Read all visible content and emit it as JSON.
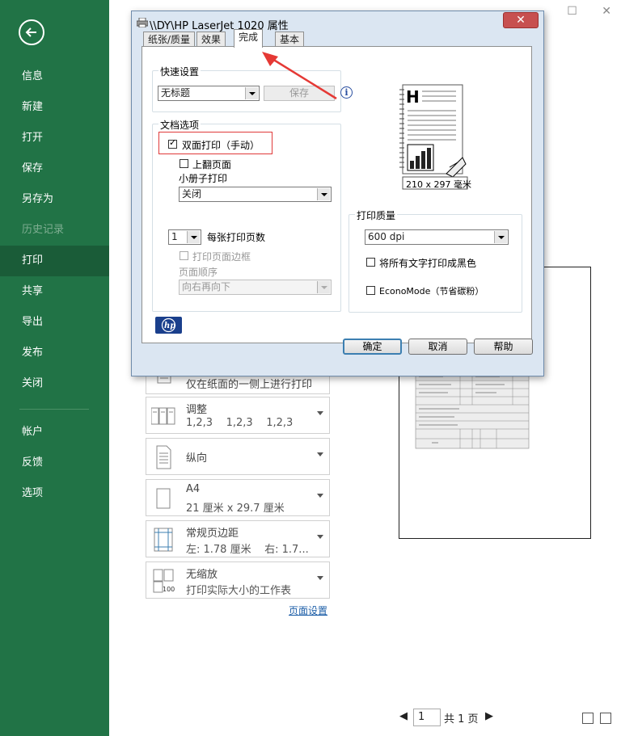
{
  "sidebar": {
    "items": [
      {
        "label": "信息"
      },
      {
        "label": "新建"
      },
      {
        "label": "打开"
      },
      {
        "label": "保存"
      },
      {
        "label": "另存为"
      },
      {
        "label": "历史记录"
      },
      {
        "label": "打印"
      },
      {
        "label": "共享"
      },
      {
        "label": "导出"
      },
      {
        "label": "发布"
      },
      {
        "label": "关闭"
      },
      {
        "label": "帐户"
      },
      {
        "label": "反馈"
      },
      {
        "label": "选项"
      }
    ]
  },
  "settings": [
    {
      "title": "仅在纸面的一侧上进行打印",
      "sub": ""
    },
    {
      "title": "调整",
      "sub": "1,2,3    1,2,3    1,2,3"
    },
    {
      "title": "纵向",
      "sub": ""
    },
    {
      "title": "A4",
      "sub": "21 厘米 x 29.7 厘米"
    },
    {
      "title": "常规页边距",
      "sub": "左: 1.78 厘米    右: 1.7..."
    },
    {
      "title": "无缩放",
      "sub": "打印实际大小的工作表"
    }
  ],
  "page_setup_link": "页面设置",
  "pager": {
    "page": "1",
    "total": "共 1 页"
  },
  "dialog": {
    "title": "\\\\DY\\HP LaserJet 1020 属性",
    "tabs": [
      "纸张/质量",
      "效果",
      "完成",
      "基本"
    ],
    "quick_settings": {
      "title": "快速设置",
      "value": "无标题",
      "save_label": "保存"
    },
    "doc_options": {
      "title": "文档选项",
      "duplex_label": "双面打印（手动）",
      "flip_label": "上翻页面",
      "booklet_label": "小册子打印",
      "booklet_value": "关闭",
      "pages_per_sheet_value": "1",
      "pages_per_sheet_label": "每张打印页数",
      "print_borders_label": "打印页面边框",
      "page_order_label": "页面顺序",
      "page_order_value": "向右再向下"
    },
    "paper_size": "210 x 297 毫米",
    "print_quality": {
      "title": "打印质量",
      "value": "600 dpi",
      "all_black_label": "将所有文字打印成黑色",
      "econo_label": "EconoMode（节省碳粉）"
    },
    "buttons": {
      "ok": "确定",
      "cancel": "取消",
      "help": "帮助"
    }
  }
}
